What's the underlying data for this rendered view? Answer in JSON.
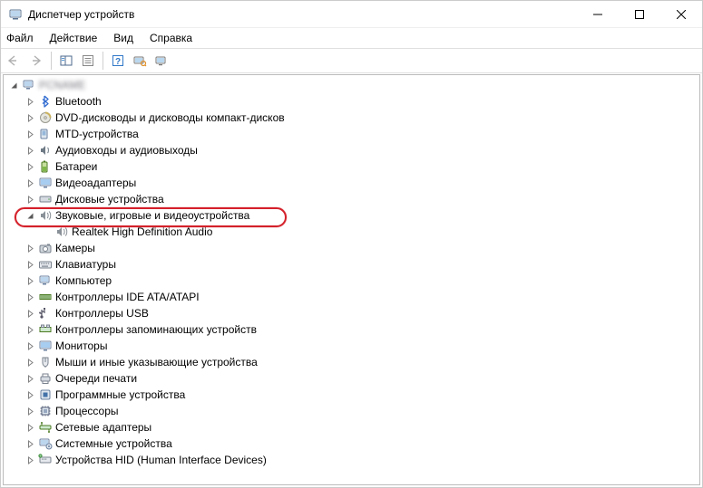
{
  "window": {
    "title": "Диспетчер устройств"
  },
  "menu": {
    "file": "Файл",
    "action": "Действие",
    "view": "Вид",
    "help": "Справка"
  },
  "root": {
    "label": "PCNAME"
  },
  "categories": [
    {
      "id": "bluetooth",
      "label": "Bluetooth",
      "expanded": false
    },
    {
      "id": "dvd",
      "label": "DVD-дисководы и дисководы компакт-дисков",
      "expanded": false
    },
    {
      "id": "mtd",
      "label": "MTD-устройства",
      "expanded": false
    },
    {
      "id": "audio-io",
      "label": "Аудиовходы и аудиовыходы",
      "expanded": false
    },
    {
      "id": "batteries",
      "label": "Батареи",
      "expanded": false
    },
    {
      "id": "display",
      "label": "Видеоадаптеры",
      "expanded": false
    },
    {
      "id": "disk",
      "label": "Дисковые устройства",
      "expanded": false
    },
    {
      "id": "sound",
      "label": "Звуковые, игровые и видеоустройства",
      "expanded": true,
      "children": [
        {
          "id": "realtek",
          "label": "Realtek High Definition Audio"
        }
      ]
    },
    {
      "id": "cameras",
      "label": "Камеры",
      "expanded": false
    },
    {
      "id": "keyboards",
      "label": "Клавиатуры",
      "expanded": false
    },
    {
      "id": "computer",
      "label": "Компьютер",
      "expanded": false
    },
    {
      "id": "ide",
      "label": "Контроллеры IDE ATA/ATAPI",
      "expanded": false
    },
    {
      "id": "usb",
      "label": "Контроллеры USB",
      "expanded": false
    },
    {
      "id": "storage-ctl",
      "label": "Контроллеры запоминающих устройств",
      "expanded": false
    },
    {
      "id": "monitors",
      "label": "Мониторы",
      "expanded": false
    },
    {
      "id": "mice",
      "label": "Мыши и иные указывающие устройства",
      "expanded": false
    },
    {
      "id": "print-queue",
      "label": "Очереди печати",
      "expanded": false
    },
    {
      "id": "software",
      "label": "Программные устройства",
      "expanded": false
    },
    {
      "id": "processors",
      "label": "Процессоры",
      "expanded": false
    },
    {
      "id": "network",
      "label": "Сетевые адаптеры",
      "expanded": false
    },
    {
      "id": "system",
      "label": "Системные устройства",
      "expanded": false
    },
    {
      "id": "hid",
      "label": "Устройства HID (Human Interface Devices)",
      "expanded": false
    }
  ]
}
